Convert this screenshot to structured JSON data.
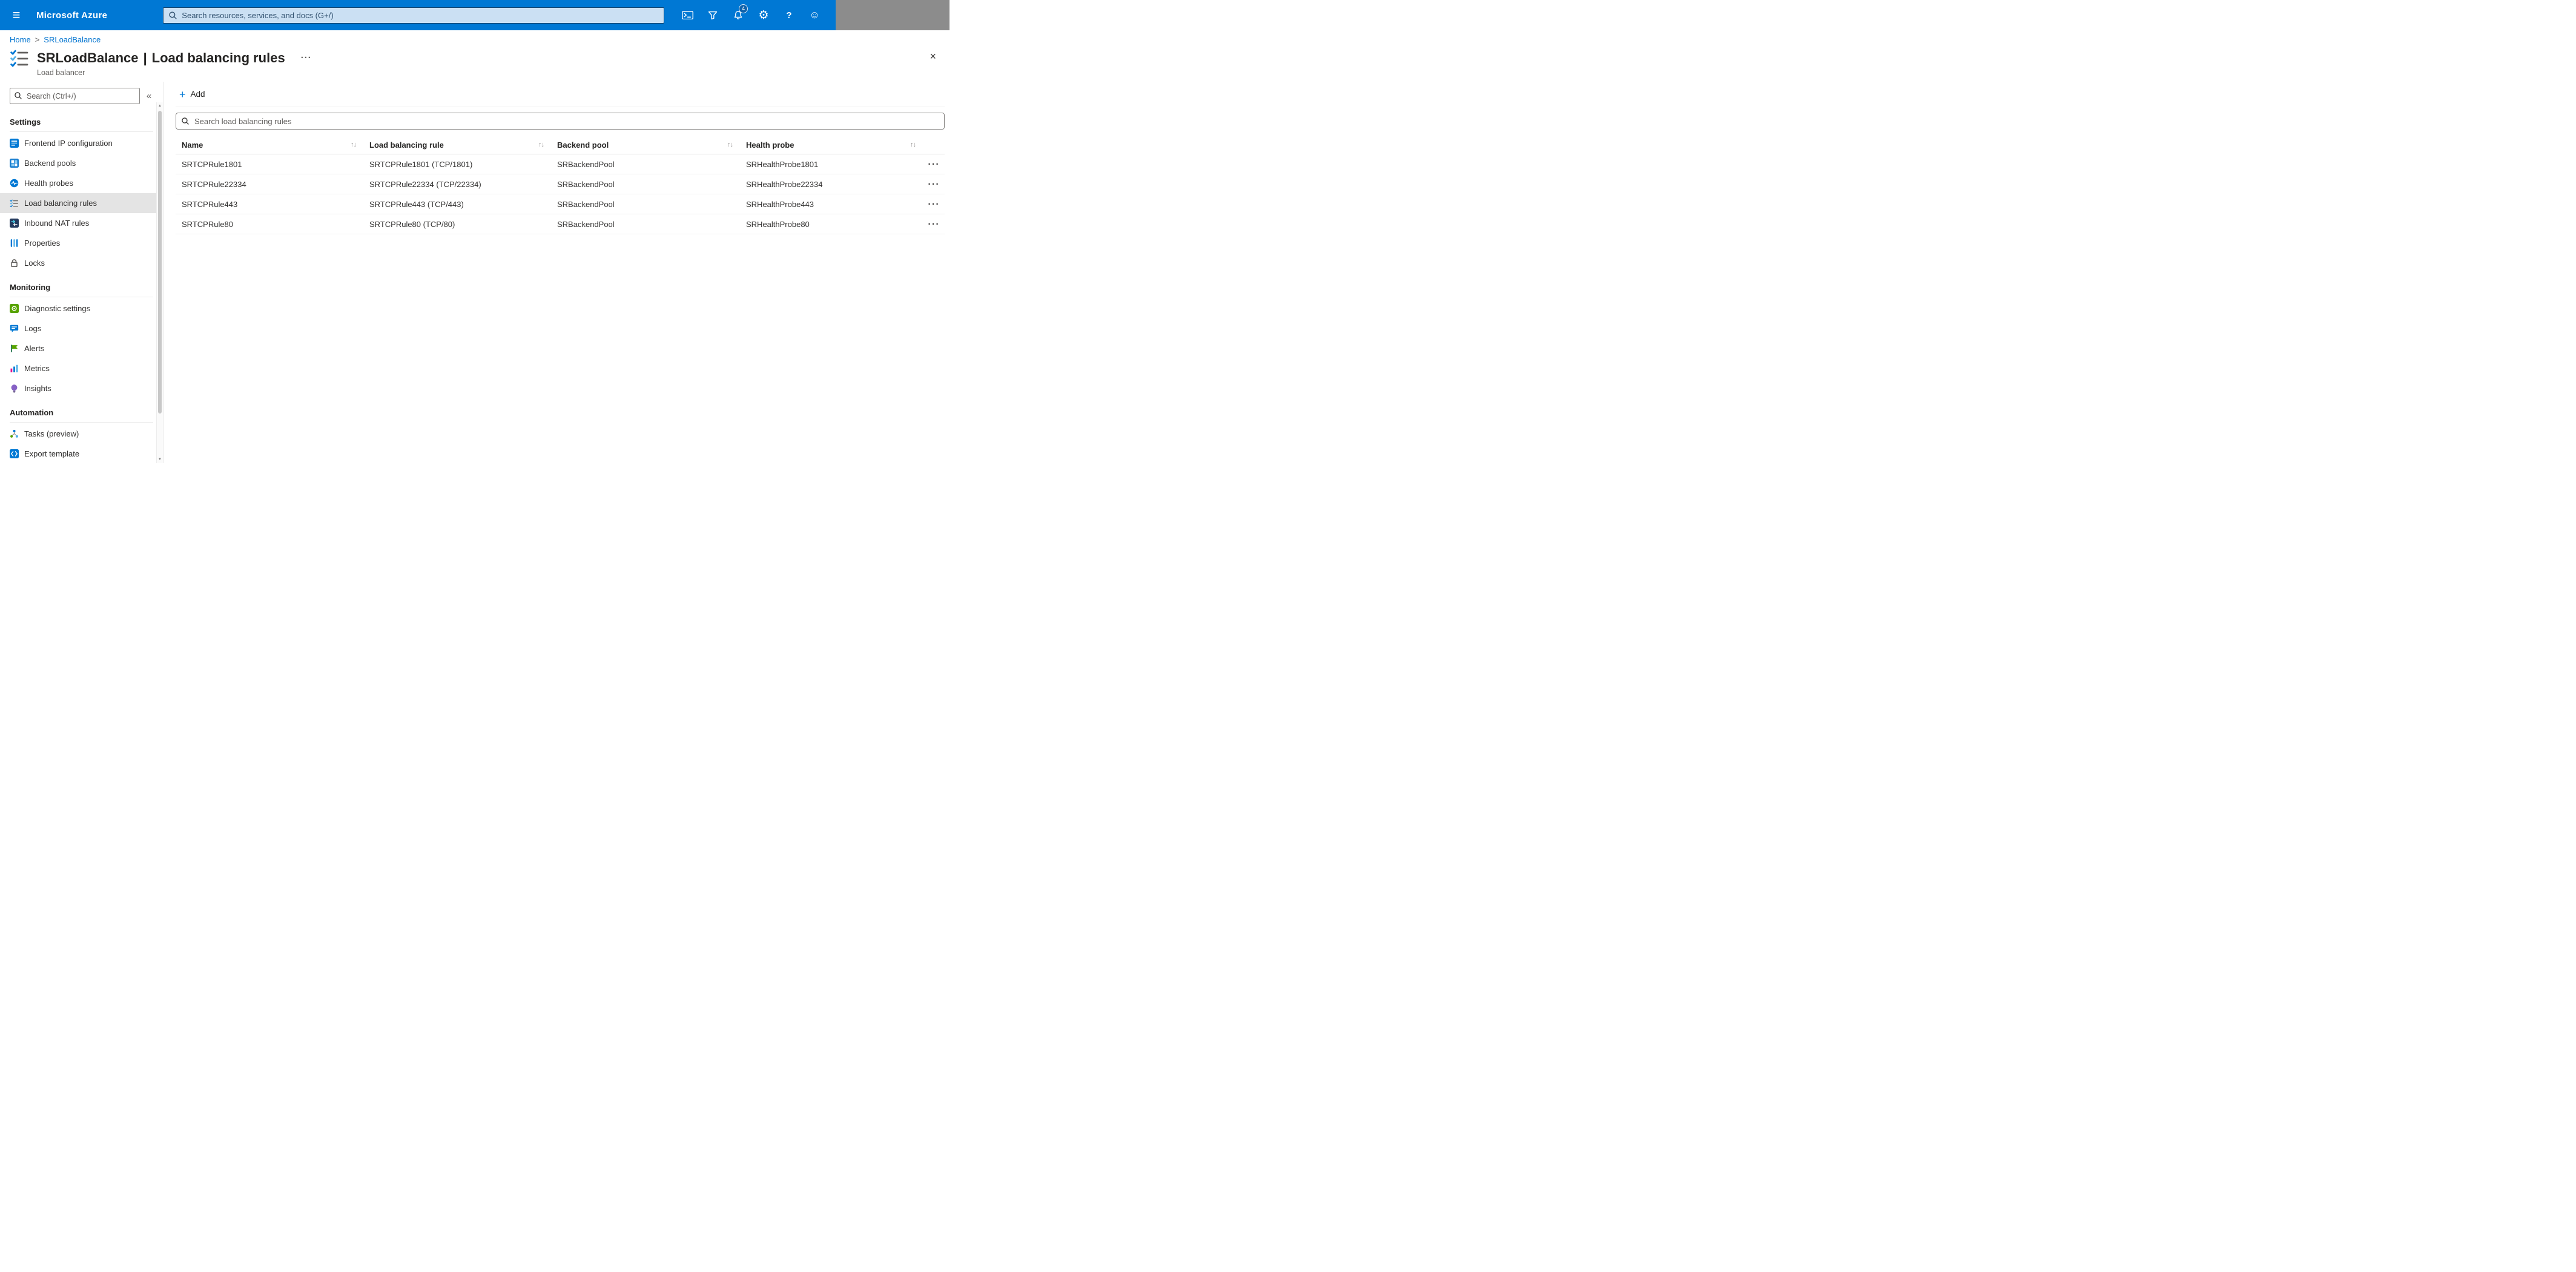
{
  "topbar": {
    "brand": "Microsoft Azure",
    "search_placeholder": "Search resources, services, and docs (G+/)",
    "notifications_badge": "4"
  },
  "icons": {
    "menu": "≡",
    "gear": "⚙",
    "help": "?",
    "smiley": "☺",
    "collapse": "«",
    "more": "···",
    "close": "×",
    "add_plus": "+",
    "sort": "↑↓",
    "row_menu": "···",
    "breadcrumb_separator": ">",
    "scroll_up": "▲",
    "scroll_down": "▼"
  },
  "breadcrumb": {
    "home": "Home",
    "current": "SRLoadBalance"
  },
  "header": {
    "title": "SRLoadBalance",
    "separator": "|",
    "blade": "Load balancing rules",
    "subtitle": "Load balancer"
  },
  "sidebar": {
    "search_placeholder": "Search (Ctrl+/)",
    "sections": [
      {
        "heading": "Settings",
        "items": [
          {
            "label": "Frontend IP configuration"
          },
          {
            "label": "Backend pools"
          },
          {
            "label": "Health probes"
          },
          {
            "label": "Load balancing rules",
            "selected": true
          },
          {
            "label": "Inbound NAT rules"
          },
          {
            "label": "Properties"
          },
          {
            "label": "Locks"
          }
        ]
      },
      {
        "heading": "Monitoring",
        "items": [
          {
            "label": "Diagnostic settings"
          },
          {
            "label": "Logs"
          },
          {
            "label": "Alerts"
          },
          {
            "label": "Metrics"
          },
          {
            "label": "Insights"
          }
        ]
      },
      {
        "heading": "Automation",
        "items": [
          {
            "label": "Tasks (preview)"
          },
          {
            "label": "Export template"
          }
        ]
      }
    ]
  },
  "toolbar": {
    "add_label": "Add"
  },
  "rules": {
    "search_placeholder": "Search load balancing rules",
    "columns": [
      "Name",
      "Load balancing rule",
      "Backend pool",
      "Health probe"
    ],
    "rows": [
      {
        "name": "SRTCPRule1801",
        "rule": "SRTCPRule1801 (TCP/1801)",
        "backend_pool": "SRBackendPool",
        "health_probe": "SRHealthProbe1801"
      },
      {
        "name": "SRTCPRule22334",
        "rule": "SRTCPRule22334 (TCP/22334)",
        "backend_pool": "SRBackendPool",
        "health_probe": "SRHealthProbe22334"
      },
      {
        "name": "SRTCPRule443",
        "rule": "SRTCPRule443 (TCP/443)",
        "backend_pool": "SRBackendPool",
        "health_probe": "SRHealthProbe443"
      },
      {
        "name": "SRTCPRule80",
        "rule": "SRTCPRule80 (TCP/80)",
        "backend_pool": "SRBackendPool",
        "health_probe": "SRHealthProbe80"
      }
    ]
  },
  "colors": {
    "accent": "#0078d4",
    "topbar": "#0078d4"
  }
}
